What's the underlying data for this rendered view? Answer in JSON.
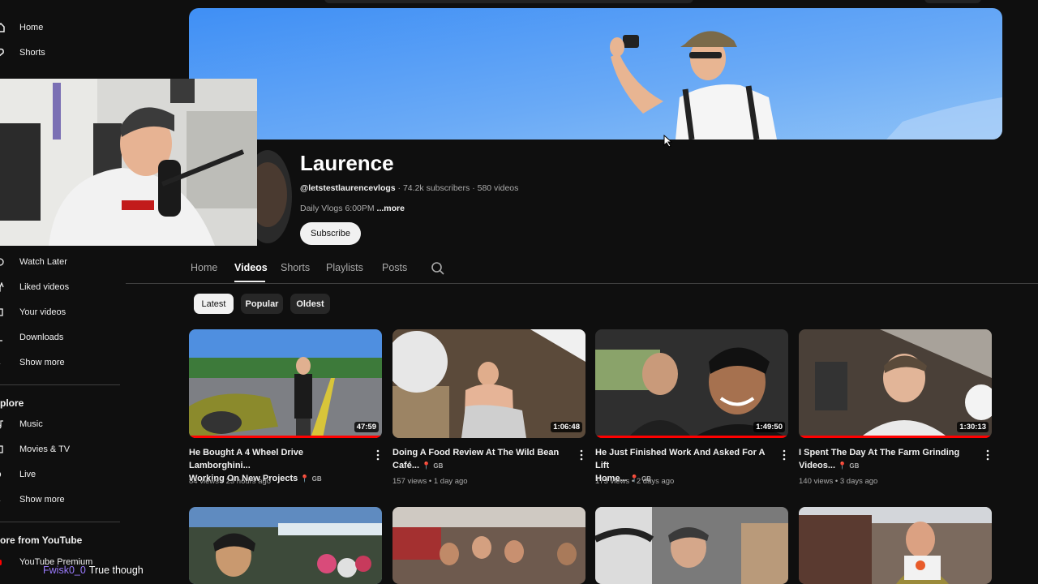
{
  "sidebar": {
    "top_items": [
      {
        "label": "Home",
        "icon": "home-icon"
      },
      {
        "label": "Shorts",
        "icon": "shorts-icon"
      }
    ],
    "you_items": [
      {
        "label": "Watch Later",
        "icon": "clock-icon"
      },
      {
        "label": "Liked videos",
        "icon": "thumbs-up-icon"
      },
      {
        "label": "Your videos",
        "icon": "play-square-icon"
      },
      {
        "label": "Downloads",
        "icon": "download-icon"
      },
      {
        "label": "Show more",
        "icon": "chevron-down-icon"
      }
    ],
    "explore_heading": "plore",
    "explore_items": [
      {
        "label": "Music",
        "icon": "music-icon"
      },
      {
        "label": "Movies & TV",
        "icon": "film-icon"
      },
      {
        "label": "Live",
        "icon": "live-icon"
      },
      {
        "label": "Show more",
        "icon": "chevron-down-icon"
      }
    ],
    "more_heading": "ore from YouTube",
    "premium_label": "YouTube Premium"
  },
  "channel": {
    "name": "Laurence",
    "handle": "@letstestlaurencevlogs",
    "subscribers": "74.2k subscribers",
    "videos_count": "580 videos",
    "description": "Daily Vlogs 6:00PM",
    "more_label": "...more",
    "subscribe_label": "Subscribe"
  },
  "tabs": [
    "Home",
    "Videos",
    "Shorts",
    "Playlists",
    "Posts"
  ],
  "active_tab": "Videos",
  "chips": [
    "Latest",
    "Popular",
    "Oldest"
  ],
  "active_chip": "Latest",
  "videos": [
    {
      "title_line1": "He Bought A 4 Wheel Drive Lamborghini...",
      "title_line2": "Working On New Projects",
      "country": "GB",
      "duration": "47:59",
      "views": "84 views",
      "age": "23 hours ago",
      "watched_fraction": 1.0
    },
    {
      "title_line1": "Doing A Food Review At The Wild Bean",
      "title_line2": "Café...",
      "country": "GB",
      "duration": "1:06:48",
      "views": "157 views",
      "age": "1 day ago",
      "watched_fraction": 0.0
    },
    {
      "title_line1": "He Just Finished Work And Asked For A Lift",
      "title_line2": "Home...",
      "country": "GB",
      "duration": "1:49:50",
      "views": "173 views",
      "age": "2 days ago",
      "watched_fraction": 1.0
    },
    {
      "title_line1": "I Spent The Day At The Farm Grinding",
      "title_line2": "Videos...",
      "country": "GB",
      "duration": "1:30:13",
      "views": "140 views",
      "age": "3 days ago",
      "watched_fraction": 1.0
    }
  ],
  "chat": {
    "user": "Fwisk0_0",
    "message": "True though"
  },
  "colors": {
    "background": "#0f0f0f",
    "accent": "#ff0000",
    "chip_bg": "#272727",
    "chat_user": "#9b7bff"
  }
}
